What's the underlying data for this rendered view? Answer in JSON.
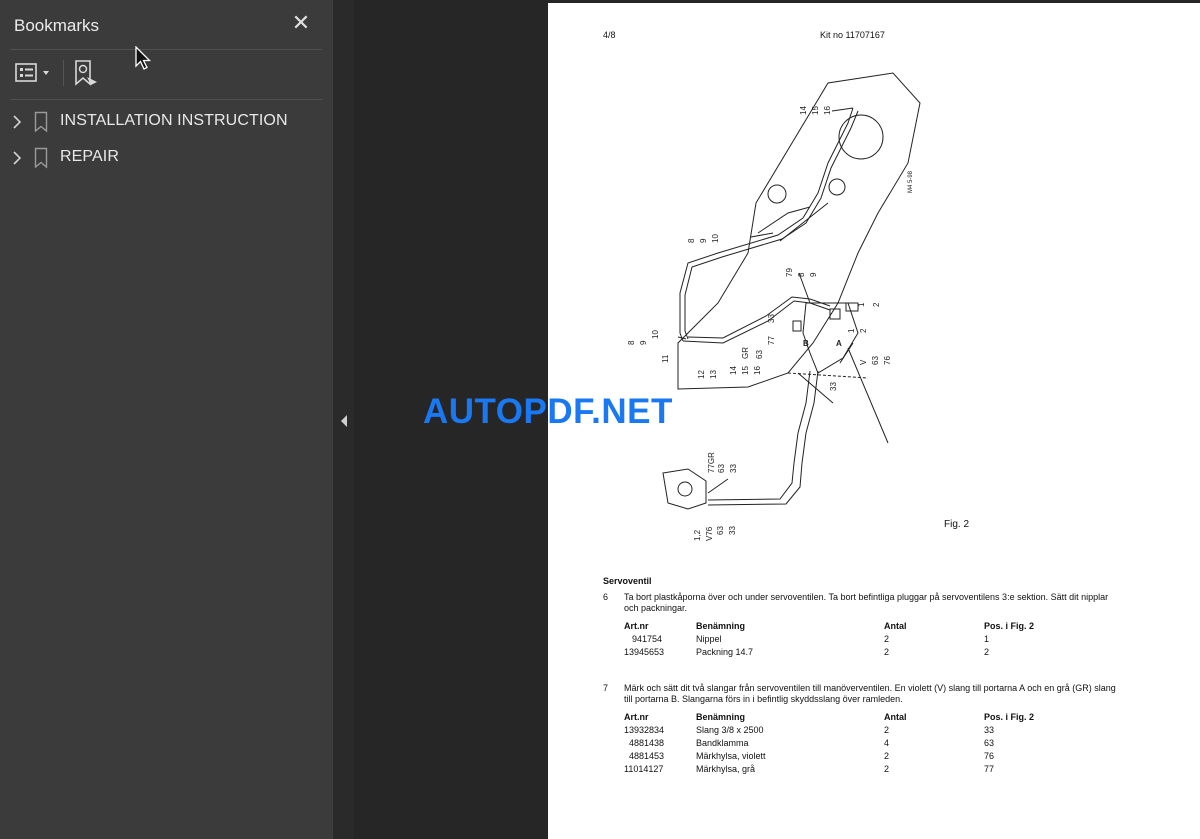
{
  "bookmarks_panel": {
    "title": "Bookmarks",
    "close_icon": "close-icon",
    "toolbar": {
      "options_icon": "list-options-icon",
      "find_icon": "find-bookmark-icon"
    },
    "items": [
      {
        "label": "INSTALLATION INSTRUCTION"
      },
      {
        "label": "REPAIR"
      }
    ]
  },
  "page": {
    "page_number": "4/8",
    "kit_number": "Kit no 11707167",
    "figure_caption": "Fig. 2",
    "figure_code": "M4 5-98",
    "figure_labels": [
      "14",
      "15",
      "16",
      "8",
      "9",
      "10",
      "79",
      "8",
      "9",
      "2",
      "1",
      "33",
      "77",
      "63",
      "GR",
      "B",
      "A",
      "2",
      "1",
      "V",
      "63",
      "76",
      "8",
      "9",
      "10",
      "11",
      "12",
      "13",
      "14",
      "15",
      "16",
      "33",
      "77GR",
      "63",
      "33",
      "1,2",
      "V76",
      "63",
      "33"
    ],
    "section_title": "Servoventil",
    "steps": [
      {
        "number": "6",
        "text": "Ta bort plastkåporna över och under servoventilen. Ta bort befintliga pluggar på servoventilens 3:e sektion. Sätt dit nipplar och packningar.",
        "headers": [
          "Art.nr",
          "Benämning",
          "Antal",
          "Pos. i Fig. 2"
        ],
        "rows": [
          [
            "941754",
            "Nippel",
            "2",
            "1"
          ],
          [
            "13945653",
            "Packning  14.7",
            "2",
            "2"
          ]
        ]
      },
      {
        "number": "7",
        "text": "Märk och sätt dit två slangar från servoventilen till manöverventilen. En violett (V) slang till portarna A och en grå (GR) slang till portarna B. Slangarna förs in i befintlig skyddsslang över ramleden.",
        "headers": [
          "Art.nr",
          "Benämning",
          "Antal",
          "Pos. i Fig. 2"
        ],
        "rows": [
          [
            "13932834",
            "Slang  3/8 x 2500",
            "2",
            "33"
          ],
          [
            "4881438",
            "Bandklamma",
            "4",
            "63"
          ],
          [
            "4881453",
            "Märkhylsa, violett",
            "2",
            "76"
          ],
          [
            "11014127",
            "Märkhylsa, grå",
            "2",
            "77"
          ]
        ]
      }
    ]
  },
  "watermark": "AUTOPDF.NET",
  "colors": {
    "panel_bg": "#3b3b3b",
    "viewer_bg": "#262626",
    "watermark": "#1a78f2"
  }
}
